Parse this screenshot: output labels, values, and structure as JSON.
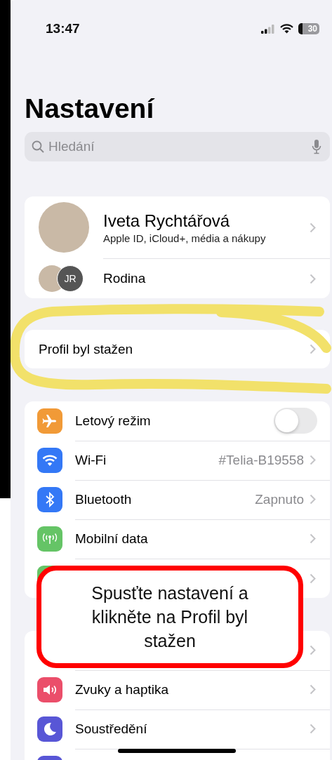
{
  "status_bar": {
    "time": "13:47",
    "battery": "30"
  },
  "title": "Nastavení",
  "search": {
    "placeholder": "Hledání"
  },
  "account": {
    "name": "Iveta Rychtářová",
    "subtitle": "Apple ID, iCloud+, média a nákupy"
  },
  "family": {
    "initials": "JR",
    "label": "Rodina"
  },
  "profile_notice": {
    "label": "Profil byl stažen"
  },
  "settings_groups": [
    {
      "rows": [
        {
          "kind": "toggle",
          "color": "#f19a37",
          "label": "Letový režim",
          "on": false
        },
        {
          "kind": "link",
          "color": "#3478f6",
          "label": "Wi-Fi",
          "value": "#Telia-B19558"
        },
        {
          "kind": "link",
          "color": "#3478f6",
          "label": "Bluetooth",
          "value": "Zapnuto"
        },
        {
          "kind": "link",
          "color": "#65c466",
          "label": "Mobilní data"
        },
        {
          "kind": "link",
          "color": "#65c466"
        }
      ]
    },
    {
      "rows": [
        {
          "kind": "link"
        },
        {
          "kind": "link",
          "color": "#eb4e6a",
          "label": "Zvuky a haptika"
        },
        {
          "kind": "link",
          "color": "#5856d6",
          "label": "Soustředění"
        },
        {
          "kind": "link",
          "color": "#5856d6"
        }
      ]
    }
  ],
  "annotation": {
    "text": "Spusťte nastavení a klikněte na Profil byl stažen"
  }
}
